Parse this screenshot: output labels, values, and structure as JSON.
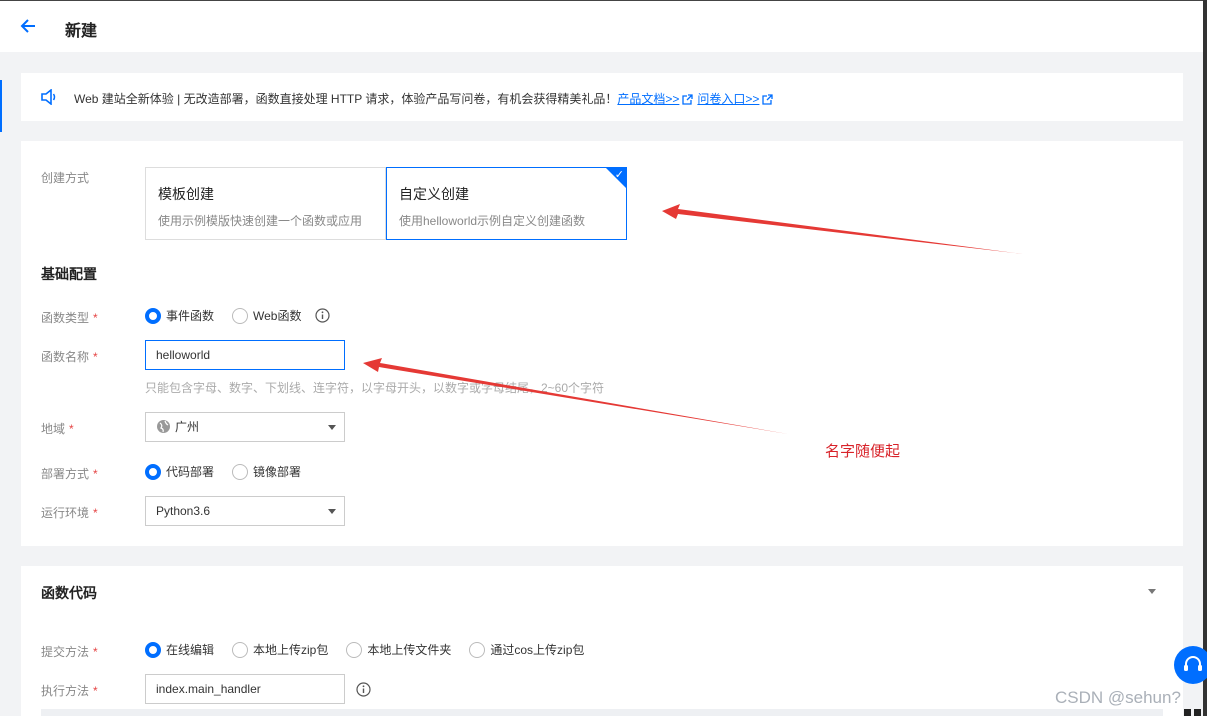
{
  "header": {
    "title": "新建"
  },
  "notice": {
    "text": "Web 建站全新体验 | 无改造部署，函数直接处理 HTTP 请求，体验产品写问卷，有机会获得精美礼品！",
    "link1": "产品文档>>",
    "link2": "问卷入口>>"
  },
  "create": {
    "label": "创建方式",
    "options": [
      {
        "title": "模板创建",
        "desc": "使用示例模版快速创建一个函数或应用"
      },
      {
        "title": "自定义创建",
        "desc": "使用helloworld示例自定义创建函数"
      }
    ],
    "selected": "自定义创建"
  },
  "basic": {
    "title": "基础配置",
    "func_type_label": "函数类型",
    "func_type_options": [
      "事件函数",
      "Web函数"
    ],
    "func_name_label": "函数名称",
    "func_name_value": "helloworld",
    "func_name_hint": "只能包含字母、数字、下划线、连字符，以字母开头，以数字或字母结尾，2~60个字符",
    "region_label": "地域",
    "region_value": "广州",
    "deploy_label": "部署方式",
    "deploy_options": [
      "代码部署",
      "镜像部署"
    ],
    "runtime_label": "运行环境",
    "runtime_value": "Python3.6"
  },
  "code": {
    "title": "函数代码",
    "submit_label": "提交方法",
    "submit_options": [
      "在线编辑",
      "本地上传zip包",
      "本地上传文件夹",
      "通过cos上传zip包"
    ],
    "handler_label": "执行方法",
    "handler_value": "index.main_handler"
  },
  "annotation": {
    "text": "名字随便起"
  },
  "watermark": {
    "text": "CSDN @sehun?"
  },
  "colors": {
    "accent": "#006eff",
    "required": "#e54545",
    "annotation": "#d8232a"
  }
}
